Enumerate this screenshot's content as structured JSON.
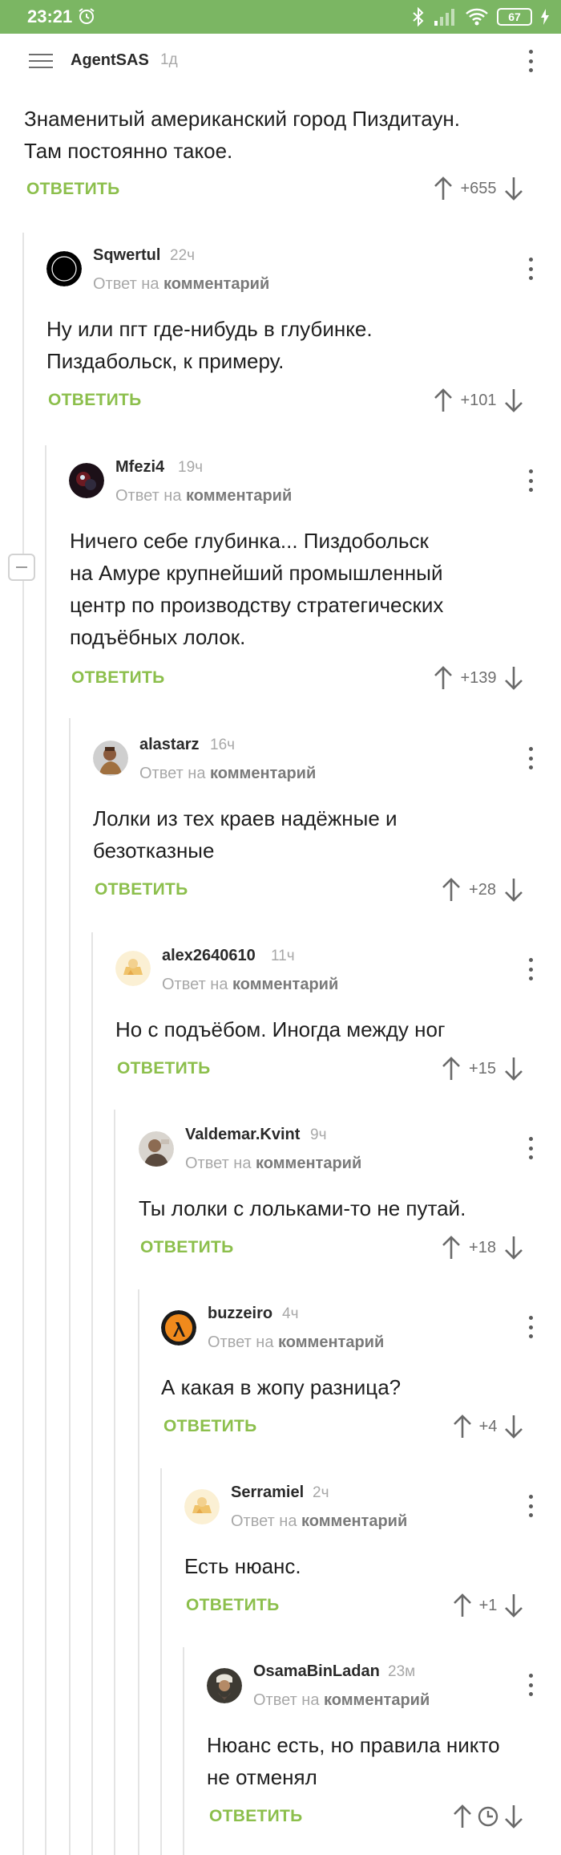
{
  "status_bar": {
    "time": "23:21",
    "battery": "67"
  },
  "top_comment": {
    "author": "AgentSAS",
    "time": "1д",
    "lines": [
      "Знаменитый американский город Пиздитаун.",
      "Там постоянно такое."
    ],
    "reply": "ОТВЕТИТЬ",
    "score": "+655"
  },
  "reply_prefix": "Ответ на",
  "reply_target": "комментарий",
  "comments": [
    {
      "author": "Sqwertul",
      "time": "22ч",
      "lines": [
        "Ну или пгт где-нибудь в глубинке.",
        "Пиздабольск, к примеру."
      ],
      "reply": "ОТВЕТИТЬ",
      "score": "+101"
    },
    {
      "author": "Mfezi4",
      "time": "19ч",
      "lines": [
        "Ничего себе глубинка... Пиздобольск",
        "на Амуре крупнейший промышленный",
        "центр по производству стратегических",
        "подъёбных лолок."
      ],
      "reply": "ОТВЕТИТЬ",
      "score": "+139"
    },
    {
      "author": "alastarz",
      "time": "16ч",
      "lines": [
        "Лолки из тех краев надёжные и",
        "безотказные"
      ],
      "reply": "ОТВЕТИТЬ",
      "score": "+28"
    },
    {
      "author": "alex2640610",
      "time": "11ч",
      "lines": [
        "Но с подъёбом. Иногда между ног"
      ],
      "reply": "ОТВЕТИТЬ",
      "score": "+15"
    },
    {
      "author": "Valdemar.Kvint",
      "time": "9ч",
      "lines": [
        "Ты лолки с лольками-то не путай."
      ],
      "reply": "ОТВЕТИТЬ",
      "score": "+18"
    },
    {
      "author": "buzzeiro",
      "time": "4ч",
      "lines": [
        "А какая в жопу разница?"
      ],
      "reply": "ОТВЕТИТЬ",
      "score": "+4"
    },
    {
      "author": "Serramiel",
      "time": "2ч",
      "lines": [
        "Есть нюанс."
      ],
      "reply": "ОТВЕТИТЬ",
      "score": "+1"
    },
    {
      "author": "OsamaBinLadan",
      "time": "23м",
      "lines": [
        "Нюанс есть, но правила никто",
        "не отменял"
      ],
      "reply": "ОТВЕТИТЬ",
      "score": ""
    }
  ]
}
